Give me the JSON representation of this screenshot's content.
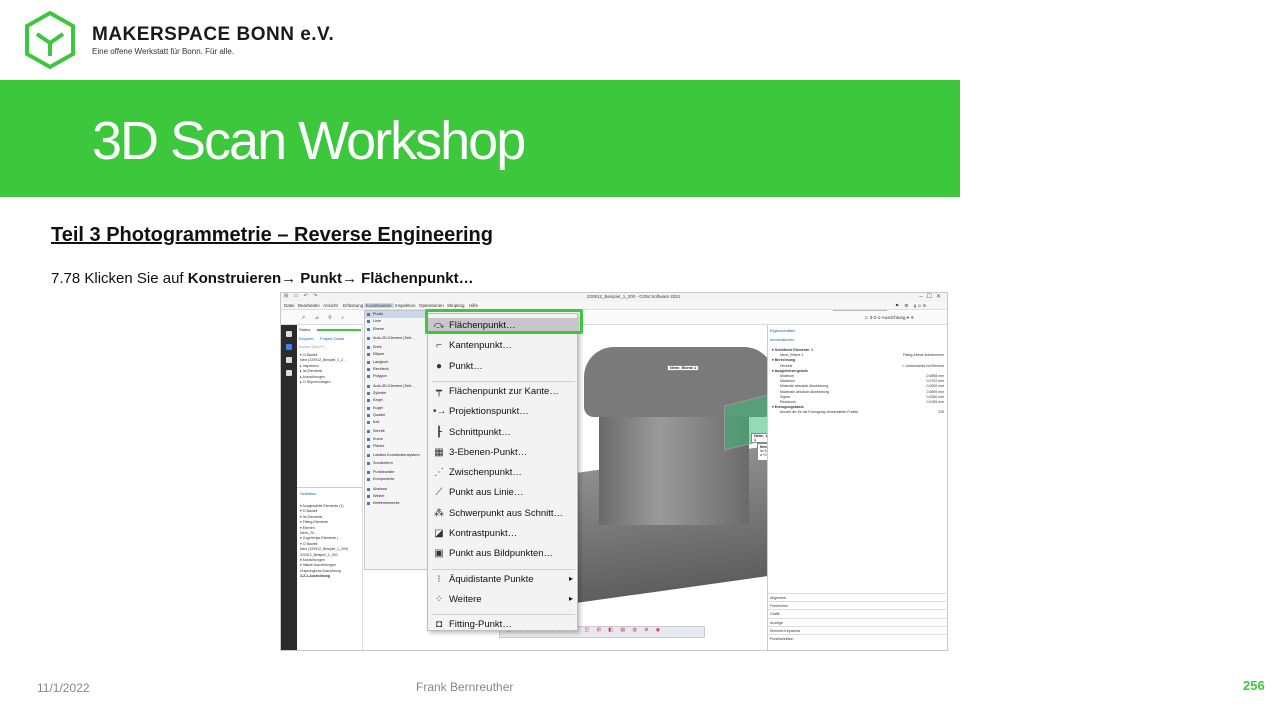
{
  "brand": {
    "name": "MAKERSPACE BONN e.V.",
    "tagline": "Eine offene Werkstatt für Bonn. Für alle.",
    "color": "#3cc73c"
  },
  "banner": {
    "title": "3D Scan Workshop"
  },
  "section": {
    "title": "Teil 3  Photogrammetrie  – Reverse Engineering"
  },
  "instruction": {
    "prefix": "7.78 Klicken Sie auf ",
    "step1": "Konstruieren",
    "step2": "Punkt",
    "step3": "Flächenpunkt…",
    "arrow": "→"
  },
  "footer": {
    "date": "11/1/2022",
    "author": "Frank Bernreuther",
    "page": "256"
  },
  "app": {
    "window_title": "220912_Beispiel_1_200 - GOM Software 2021",
    "menu": [
      "Datei",
      "Bearbeiten",
      "Ansicht",
      "Erfassung",
      "Konstruieren",
      "Inspektion",
      "Operationen",
      "Skripting",
      "Hilfe"
    ],
    "search_placeholder": "In Direkthilfe suchen",
    "alignment": "3-2-1-Ausrichtung",
    "explorer": {
      "status": "Status",
      "tabs": [
        "Explorer",
        "Projekt-Guide"
      ],
      "search": "Suchen (Strg+F)",
      "tree": [
        "▾ ⊡ Bauteil",
        "  Netz (220912_Beispiel_1_2…",
        "  ▸ Inspektion",
        "  ▸ Ist-Elemente",
        "  ▸ Ausrichtungen",
        "▸ ⊡ Reportvorlagen"
      ]
    },
    "selection": {
      "header": "Selektion",
      "tree": [
        "▾ Ausgewählte Elemente (1)",
        "  ▾ ⊡ Bauteil",
        "    ▾ Ist-Elemente",
        "      ▾ Fitting-Elemente",
        "        ▾ Ebenen",
        "          Nenn_St…",
        "▾ Zugehörige Elemente (…",
        "  ▾ ⊡ Bauteil",
        "    Netz (220912_Beispiel_1_200)",
        "      220912_Beispiel_1_200",
        "    ▾ Ausrichtungen",
        "      ▾ Initiale Ausrichtungen",
        "        Ursprüngliche Ausrichtung",
        "        3-2-1-Ausrichtung"
      ]
    },
    "konstruieren_items": [
      "Punkt",
      "Linie",
      "Ebene",
      "",
      "Auto-2D-Element (Selt…",
      "",
      "Kreis",
      "Ellipse",
      "Langloch",
      "Rechteck",
      "Polygon",
      "",
      "Auto-3D-Element (Selt…",
      "Zylinder",
      "Kegel",
      "Kugel",
      "Quader",
      "Keil",
      "",
      "Schnitt",
      "Kurve",
      "Fläche",
      "",
      "Lokales Koordinatensystem",
      "Sonderform",
      "",
      "Punktewolke",
      "Komponente",
      "",
      "Abstand",
      "Winkel",
      "Kletterelemente"
    ],
    "labels3d": {
      "plane": "Nenn_Ebene 1",
      "angle": "Nenn_Winkel 1",
      "table_title": "Nenn_Winkel",
      "table_head": "Ist     Soll     Ist     Abw.     Prüfung",
      "table_row": "a    +0.00   +77.48   +77.48  (Nenn_Winkel)"
    },
    "props": {
      "tabs": "Eigenschaften",
      "info": "Informationen",
      "rows": [
        {
          "k": "▾ Selektierte Elemente: 1",
          "v": "",
          "h": true
        },
        {
          "k": "Nenn_Ebene 1",
          "v": "Fitting-Ebene konstruieren",
          "h": false
        },
        {
          "k": "▾ Berechnung",
          "v": "",
          "h": true
        },
        {
          "k": "Hinweis",
          "v": "⚠ Unbenutztes Ist-Element",
          "h": false
        },
        {
          "k": "▾ Ausgleichsergebnis",
          "v": "",
          "h": true
        },
        {
          "k": "Minimum",
          "v": "-0.0898 mm",
          "h": false
        },
        {
          "k": "Maximum",
          "v": "0.0702 mm",
          "h": false
        },
        {
          "k": "Minimale absolute Abweichung",
          "v": "0.0000 mm",
          "h": false
        },
        {
          "k": "Maximale absolute Abweichung",
          "v": "0.0899 mm",
          "h": false
        },
        {
          "k": "Sigma",
          "v": "0.0260 mm",
          "h": false
        },
        {
          "k": "Residuum",
          "v": "0.0155 mm",
          "h": false
        },
        {
          "k": "▾ Erzeugungsbasis",
          "v": "",
          "h": true
        },
        {
          "k": "Anzahl der für die Erzeugung verwendeten Punkte",
          "v": "225",
          "h": false
        }
      ],
      "footer": [
        "Allgemein",
        "Fehlerchen",
        "Grafik",
        "Anzeige",
        "Element-Keywords",
        "Punktselektion"
      ]
    }
  },
  "context_menu": {
    "items": [
      {
        "label": "Flächenpunkt…",
        "icon": "surface-point-icon",
        "glyph": "⤼",
        "selected": true
      },
      {
        "label": "Kantenpunkt…",
        "icon": "edge-point-icon",
        "glyph": "⌐"
      },
      {
        "label": "Punkt…",
        "icon": "point-icon",
        "glyph": "●"
      },
      {
        "label": "Flächenpunkt zur Kante…",
        "icon": "surface-point-edge-icon",
        "glyph": "┯",
        "sep_before": true
      },
      {
        "label": "Projektionspunkt…",
        "icon": "projection-point-icon",
        "glyph": "•→"
      },
      {
        "label": "Schnittpunkt…",
        "icon": "intersection-point-icon",
        "glyph": "┠"
      },
      {
        "label": "3-Ebenen-Punkt…",
        "icon": "three-plane-point-icon",
        "glyph": "▦"
      },
      {
        "label": "Zwischenpunkt…",
        "icon": "midpoint-icon",
        "glyph": "⋰"
      },
      {
        "label": "Punkt aus Linie…",
        "icon": "point-from-line-icon",
        "glyph": "⟋"
      },
      {
        "label": "Schwerpunkt aus Schnitt…",
        "icon": "centroid-icon",
        "glyph": "⁂"
      },
      {
        "label": "Kontrastpunkt…",
        "icon": "contrast-point-icon",
        "glyph": "◪"
      },
      {
        "label": "Punkt aus Bildpunkten…",
        "icon": "image-point-icon",
        "glyph": "▣"
      },
      {
        "label": "Äquidistante Punkte",
        "icon": "equidistant-points-icon",
        "glyph": "⁝",
        "submenu": true,
        "sep_before": true
      },
      {
        "label": "Weitere",
        "icon": "more-icon",
        "glyph": "⁘",
        "submenu": true
      },
      {
        "label": "Fitting-Punkt…",
        "icon": "fitting-point-icon",
        "glyph": "◘",
        "sep_before": true
      }
    ]
  }
}
